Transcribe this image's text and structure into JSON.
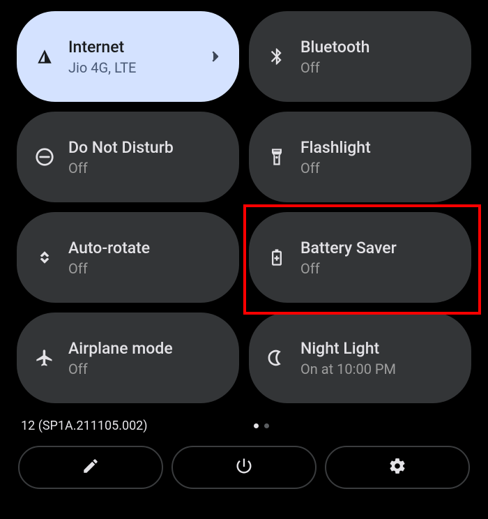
{
  "tiles": [
    {
      "title": "Internet",
      "subtitle": "Jio 4G, LTE",
      "icon": "signal-icon",
      "active": true,
      "hasChevron": true
    },
    {
      "title": "Bluetooth",
      "subtitle": "Off",
      "icon": "bluetooth-icon",
      "active": false
    },
    {
      "title": "Do Not Disturb",
      "subtitle": "Off",
      "icon": "dnd-icon",
      "active": false
    },
    {
      "title": "Flashlight",
      "subtitle": "Off",
      "icon": "flashlight-icon",
      "active": false
    },
    {
      "title": "Auto-rotate",
      "subtitle": "Off",
      "icon": "autorotate-icon",
      "active": false
    },
    {
      "title": "Battery Saver",
      "subtitle": "Off",
      "icon": "battery-icon",
      "active": false,
      "highlighted": true
    },
    {
      "title": "Airplane mode",
      "subtitle": "Off",
      "icon": "airplane-icon",
      "active": false
    },
    {
      "title": "Night Light",
      "subtitle": "On at 10:00 PM",
      "icon": "nightlight-icon",
      "active": false
    }
  ],
  "buildText": "12 (SP1A.211105.002)",
  "pageIndicator": {
    "count": 2,
    "activeIndex": 0
  },
  "bottomButtons": [
    "edit-icon",
    "power-icon",
    "settings-icon"
  ]
}
